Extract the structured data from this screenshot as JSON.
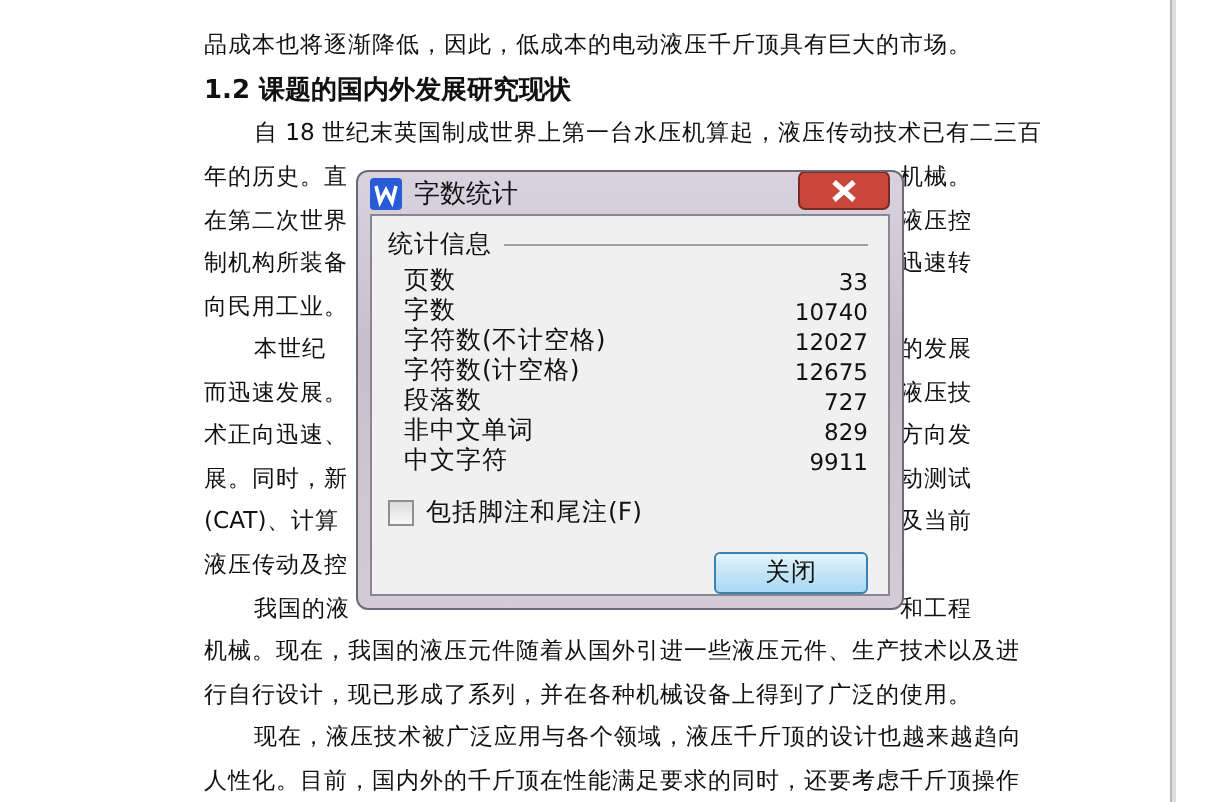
{
  "document": {
    "lines": [
      {
        "kind": "full",
        "indent": false,
        "text": "品成本也将逐渐降低，因此，低成本的电动液压千斤顶具有巨大的市场。"
      },
      {
        "kind": "heading",
        "indent": false,
        "text": "1.2 课题的国内外发展研究现状"
      },
      {
        "kind": "full",
        "indent": true,
        "text": "自 18 世纪末英国制成世界上第一台水压机算起，液压传动技术已有二三百"
      },
      {
        "kind": "split",
        "indent": false,
        "left": "年的历史。直",
        "right": "机械。"
      },
      {
        "kind": "split",
        "indent": false,
        "left": "在第二次世界",
        "right": "液压控"
      },
      {
        "kind": "split",
        "indent": false,
        "left": "制机构所装备",
        "right": "迅速转"
      },
      {
        "kind": "split",
        "indent": false,
        "left": "向民用工业。"
      },
      {
        "kind": "split",
        "indent": true,
        "left": "本世纪",
        "right": "的发展"
      },
      {
        "kind": "split",
        "indent": false,
        "left": "而迅速发展。",
        "right": "液压技"
      },
      {
        "kind": "split",
        "indent": false,
        "left": "术正向迅速、",
        "right": "方向发"
      },
      {
        "kind": "split",
        "indent": false,
        "left": "展。同时，新",
        "right": "动测试"
      },
      {
        "kind": "split",
        "indent": false,
        "left": "(CAT)、计算",
        "right": "及当前"
      },
      {
        "kind": "split",
        "indent": false,
        "left": "液压传动及控"
      },
      {
        "kind": "split",
        "indent": true,
        "left": "我国的液",
        "right": "和工程"
      },
      {
        "kind": "full",
        "indent": false,
        "text": "机械。现在，我国的液压元件随着从国外引进一些液压元件、生产技术以及进"
      },
      {
        "kind": "full",
        "indent": false,
        "text": "行自行设计，现已形成了系列，并在各种机械设备上得到了广泛的使用。"
      },
      {
        "kind": "full",
        "indent": true,
        "text": "现在，液压技术被广泛应用与各个领域，液压千斤顶的设计也越来越趋向"
      },
      {
        "kind": "full",
        "indent": false,
        "text": "人性化。目前，国内外的千斤顶在性能满足要求的同时，还要考虑千斤顶操作"
      }
    ]
  },
  "dialog": {
    "title": "字数统计",
    "section": "统计信息",
    "stats": [
      {
        "label": "页数",
        "value": "33"
      },
      {
        "label": "字数",
        "value": "10740"
      },
      {
        "label": "字符数(不计空格)",
        "value": "12027"
      },
      {
        "label": "字符数(计空格)",
        "value": "12675"
      },
      {
        "label": "段落数",
        "value": "727"
      },
      {
        "label": "非中文单词",
        "value": "829"
      },
      {
        "label": "中文字符",
        "value": "9911"
      }
    ],
    "checkbox": {
      "label": "包括脚注和尾注(F)",
      "checked": false
    },
    "button": "关闭"
  }
}
